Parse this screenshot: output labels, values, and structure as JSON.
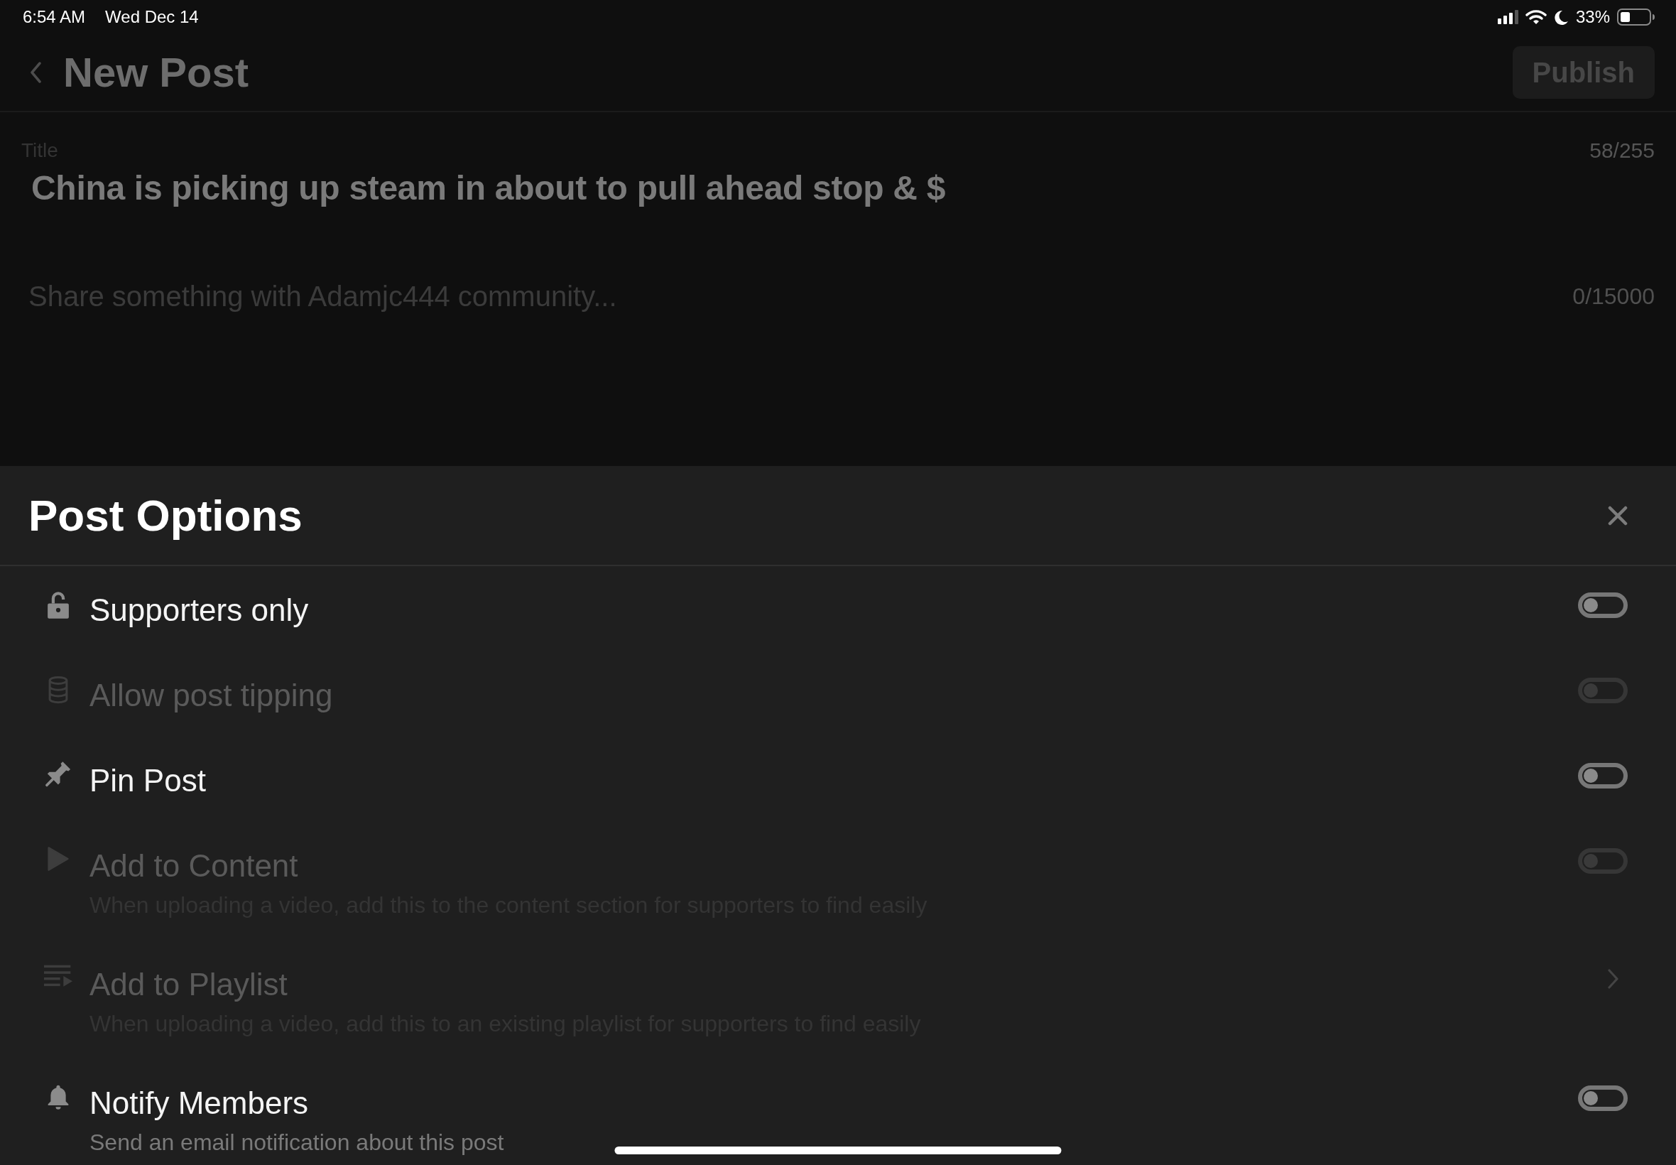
{
  "status_bar": {
    "time": "6:54 AM",
    "date": "Wed Dec 14",
    "battery": "33%"
  },
  "header": {
    "title": "New Post",
    "publish_button": {
      "label": "Publish",
      "disabled": true
    }
  },
  "editor": {
    "title_field": {
      "label": "Title",
      "value": "China is picking up steam in about to pull ahead stop & $",
      "counter": "58/255"
    },
    "body_field": {
      "placeholder": "Share something with Adamjc444 community...",
      "counter": "0/15000"
    }
  },
  "post_options": {
    "title": "Post Options",
    "items": [
      {
        "kind": "toggle",
        "label": "Supporters only",
        "on": false,
        "disabled": false
      },
      {
        "kind": "toggle",
        "label": "Allow post tipping",
        "on": false,
        "disabled": true
      },
      {
        "kind": "toggle",
        "label": "Pin Post",
        "on": false,
        "disabled": false
      },
      {
        "kind": "toggle",
        "label": "Add to Content",
        "description": "When uploading a video, add this to the content section for supporters to find easily",
        "on": false,
        "disabled": true
      },
      {
        "kind": "link",
        "label": "Add to Playlist",
        "description": "When uploading a video, add this to an existing playlist for supporters to find easily",
        "disabled": true
      },
      {
        "kind": "toggle",
        "label": "Notify Members",
        "description": "Send an email notification about this post",
        "on": false,
        "disabled": false
      }
    ]
  }
}
